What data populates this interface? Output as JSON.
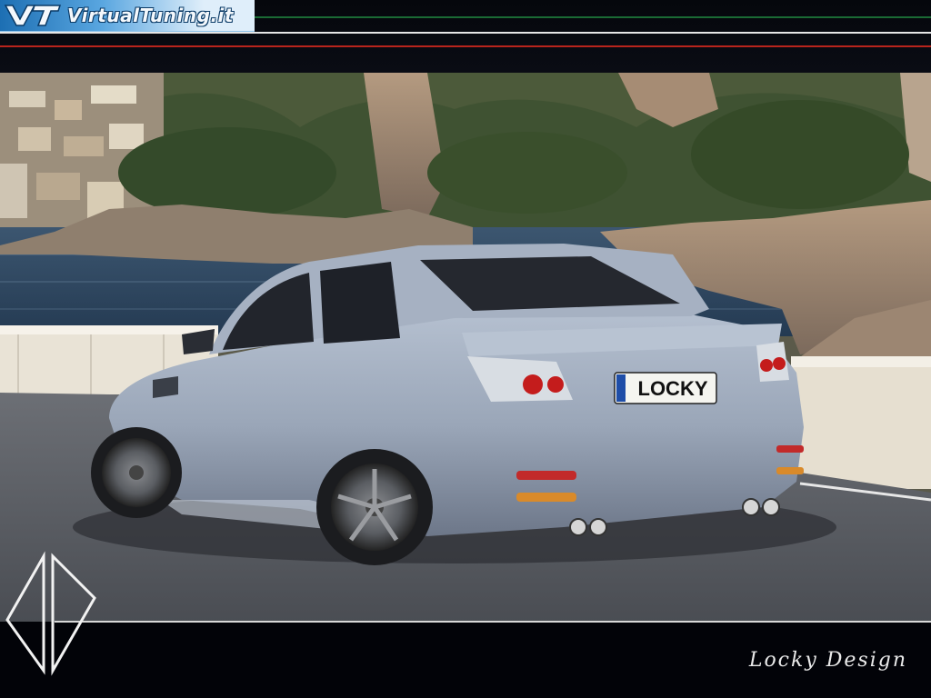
{
  "header": {
    "site_name": "VirtualTuning.it",
    "accent_colors": {
      "green": "#1a6a34",
      "white": "#e6e6e6",
      "red": "#b9241c",
      "logo_blue": "#2b7cc0"
    }
  },
  "photo": {
    "plate_text": "LOCKY",
    "car_color": "#9aa6b8"
  },
  "footer": {
    "signature": "Locky Design",
    "monogram_icon": "ld-monogram-icon"
  }
}
